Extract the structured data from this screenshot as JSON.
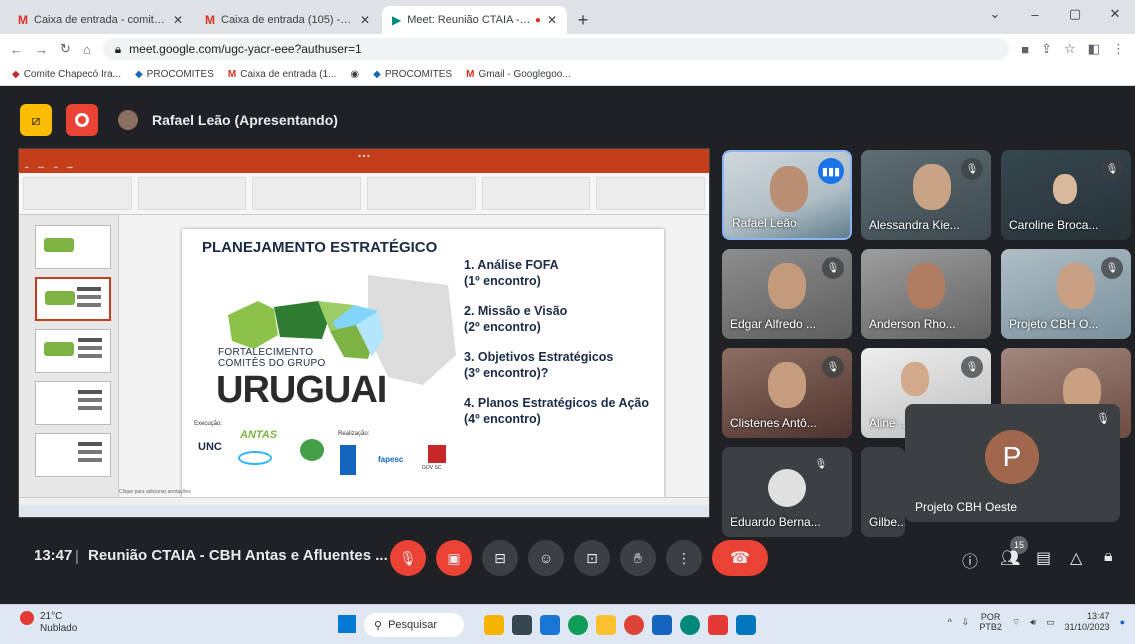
{
  "browser": {
    "tabs": [
      {
        "label": "Caixa de entrada - comitechapo...",
        "icon": "gmail-icon"
      },
      {
        "label": "Caixa de entrada (105) - projeto...",
        "icon": "gmail-icon"
      },
      {
        "label": "Meet: Reunião CTAIA - CBH",
        "icon": "meet-icon",
        "recording": true
      }
    ],
    "url": "meet.google.com/ugc-yacr-eee?authuser=1",
    "bookmarks": [
      "Comite Chapecó Ira...",
      "PROCOMITES",
      "Caixa de entrada (1...",
      "PROCOMITES",
      "Gmail - Googlegoo..."
    ]
  },
  "meet": {
    "presenter": "Rafael Leão (Apresentando)",
    "time": "13:47",
    "meeting_title": "Reunião CTAIA - CBH Antas e Afluentes ...",
    "participant_count": "15"
  },
  "slide": {
    "title": "PLANEJAMENTO ESTRATÉGICO",
    "brand_line1": "FORTALECIMENTO",
    "brand_line2": "COMITÊS DO GRUPO",
    "brand_big": "URUGUAI",
    "agenda": [
      {
        "line1": "1. Análise FOFA",
        "line2": "(1º encontro)"
      },
      {
        "line1": "2. Missão e Visão",
        "line2": "(2º encontro)"
      },
      {
        "line1": "3. Objetivos Estratégicos",
        "line2": "(3º encontro)?"
      },
      {
        "line1": "4. Planos Estratégicos de Ação",
        "line2": "(4º encontro)"
      }
    ],
    "execucao_label": "Execução:",
    "realizacao_label": "Realização:",
    "logo_unc": "UNC",
    "logo_antas": "ANTAS",
    "logo_fapesc": "fapesc",
    "logo_sc": "GOV SC",
    "notes_placeholder": "Clique para adicionar anotações"
  },
  "participants": [
    {
      "name": "Rafael Leão",
      "speaking": true
    },
    {
      "name": "Alessandra Kie...",
      "muted": true
    },
    {
      "name": "Caroline Broca...",
      "muted": true
    },
    {
      "name": "Edgar Alfredo ...",
      "muted": true
    },
    {
      "name": "Anderson Rho...",
      "muted": false
    },
    {
      "name": "Projeto CBH O...",
      "muted": true
    },
    {
      "name": "Clistenes Antô...",
      "muted": true
    },
    {
      "name": "Aline ...",
      "muted": true
    },
    {
      "name": "",
      "muted": false
    },
    {
      "name": "Eduardo Berna...",
      "muted": true
    },
    {
      "name": "Gilbe...",
      "muted": false
    }
  ],
  "overlay_participant": {
    "initial": "P",
    "name": "Projeto CBH Oeste"
  },
  "taskbar": {
    "weather_temp": "21°C",
    "weather_desc": "Nublado",
    "search_placeholder": "Pesquisar",
    "lang1": "POR",
    "lang2": "PTB2",
    "time": "13:47",
    "date": "31/10/2023"
  }
}
